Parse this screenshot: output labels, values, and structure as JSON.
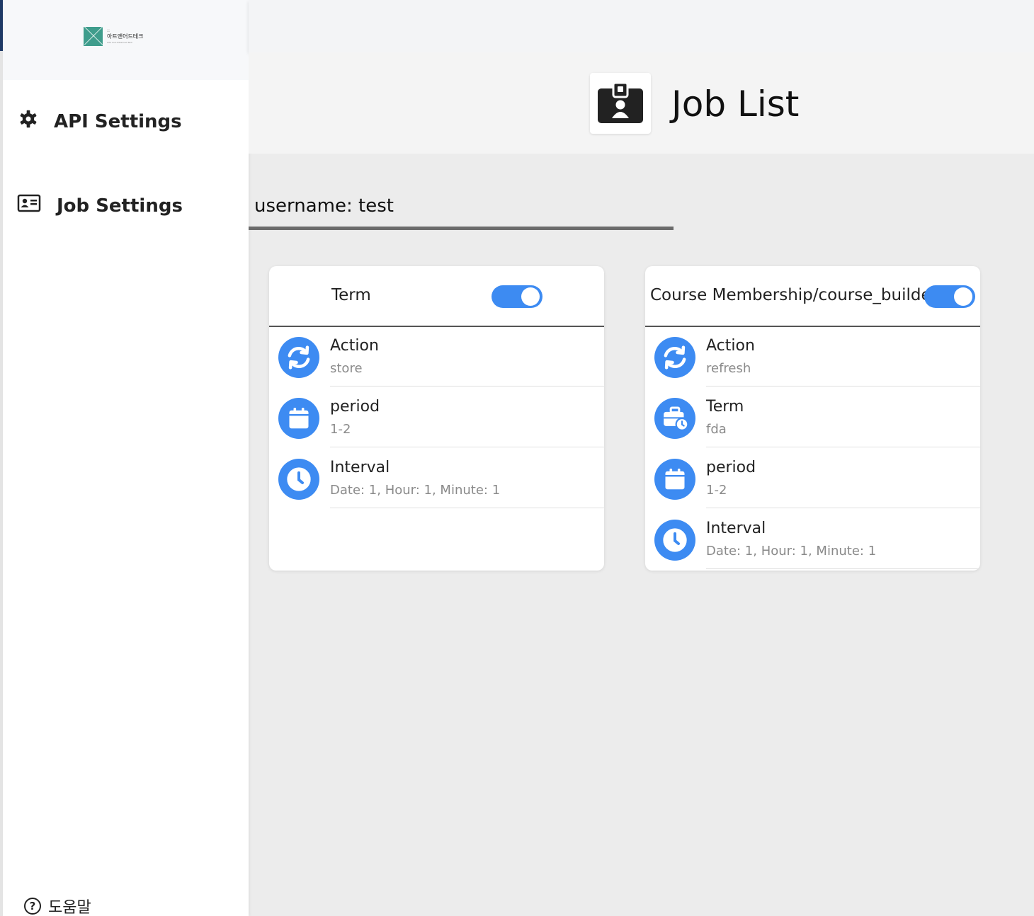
{
  "sidebar": {
    "logo": {
      "dots": "::",
      "name": "아트앤어드테크",
      "sub": "Arts and Advanced Tech"
    },
    "items": [
      {
        "label": "API Settings",
        "icon": "gear-icon"
      },
      {
        "label": "Job Settings",
        "icon": "id-card-icon"
      }
    ],
    "help_label": "도움말",
    "help_icon": "?"
  },
  "header": {
    "title": "Job List",
    "icon": "id-badge-icon"
  },
  "user": {
    "text": "username: test"
  },
  "colors": {
    "accent": "#3d8bf2",
    "sidebar_bg": "#ffffff",
    "content_bg": "#ececec",
    "logo": "#3f9d8c"
  },
  "cards": [
    {
      "title": "Term",
      "enabled": true,
      "rows": [
        {
          "label": "Action",
          "value": "store",
          "icon": "refresh-icon"
        },
        {
          "label": "period",
          "value": "1-2",
          "icon": "calendar-icon"
        },
        {
          "label": "Interval",
          "value": "Date: 1, Hour: 1, Minute: 1",
          "icon": "clock-icon"
        }
      ]
    },
    {
      "title": "Course Membership/course_builder",
      "enabled": true,
      "rows": [
        {
          "label": "Action",
          "value": "refresh",
          "icon": "refresh-icon"
        },
        {
          "label": "Term",
          "value": "fda",
          "icon": "briefcase-clock-icon"
        },
        {
          "label": "period",
          "value": "1-2",
          "icon": "calendar-icon"
        },
        {
          "label": "Interval",
          "value": "Date: 1, Hour: 1, Minute: 1",
          "icon": "clock-icon"
        }
      ]
    }
  ]
}
